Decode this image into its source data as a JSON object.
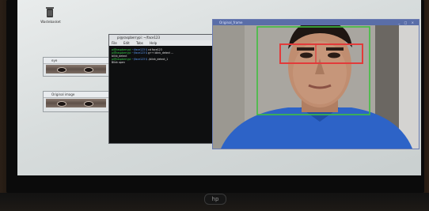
{
  "desktop": {
    "trash_label": "Wastebasket"
  },
  "windows": {
    "eye_window_1": {
      "title": "eye"
    },
    "eye_window_2": {
      "title": "Original image"
    },
    "terminal": {
      "title": "pi@raspberrypi: ~/face123",
      "menu": [
        "File",
        "Edit",
        "Tabs",
        "Help"
      ],
      "lines": [
        {
          "prompt": "pi@raspberrypi",
          "path": " ~/face123 $ ",
          "cmd": "cd face123"
        },
        {
          "prompt": "pi@raspberrypi",
          "path": " ~/face123 $ ",
          "cmd": "g++ blink_detect ..."
        },
        {
          "prompt": "",
          "path": "",
          "cmd": "blink_detect"
        },
        {
          "prompt": "pi@raspberrypi",
          "path": " ~/face123 $ ",
          "cmd": "./blink_detect_1"
        },
        {
          "prompt": "",
          "path": "",
          "cmd": "Blink open"
        }
      ]
    },
    "original_frame": {
      "title": "Original_frame",
      "controls": "_ □ ×"
    }
  },
  "monitor": {
    "brand": "hp"
  },
  "colors": {
    "face_box": "#3fbf3f",
    "eye_box": "#e23a3a",
    "title_bar": "#5a6ea8"
  }
}
